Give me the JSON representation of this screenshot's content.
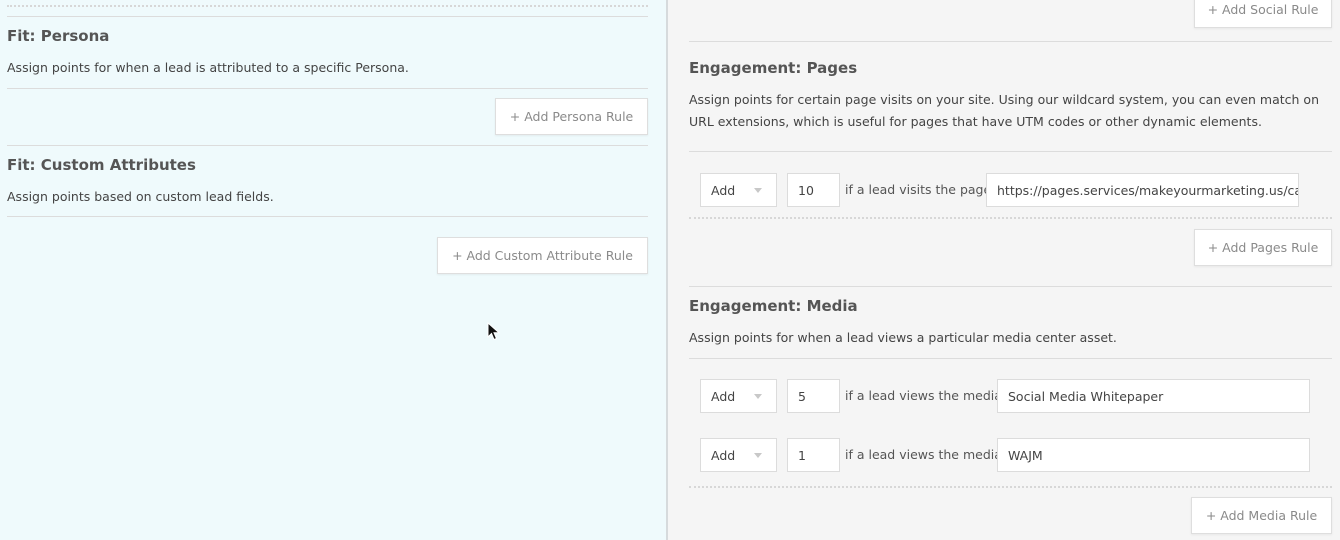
{
  "left": {
    "persona": {
      "title": "Fit: Persona",
      "description": "Assign points for when a lead is attributed to a specific Persona.",
      "button": "+ Add Persona Rule"
    },
    "custom": {
      "title": "Fit: Custom Attributes",
      "description": "Assign points based on custom lead fields.",
      "button": "+ Add Custom Attribute Rule"
    }
  },
  "right": {
    "social_button": "+ Add Social Rule",
    "pages": {
      "title": "Engagement: Pages",
      "description": "Assign points for certain page visits on your site. Using our wildcard system, you can even match on URL extensions, which is useful for pages that have UTM codes or other dynamic elements.",
      "rules": [
        {
          "action": "Add",
          "points": "10",
          "condition": "if a lead visits the page",
          "value": "https://pages.services/makeyourmarketing.us/car"
        }
      ],
      "button": "+ Add Pages Rule"
    },
    "media": {
      "title": "Engagement: Media",
      "description": "Assign points for when a lead views a particular media center asset.",
      "rules": [
        {
          "action": "Add",
          "points": "5",
          "condition": "if a lead views the media",
          "value": "Social Media Whitepaper"
        },
        {
          "action": "Add",
          "points": "1",
          "condition": "if a lead views the media",
          "value": "WAJM"
        }
      ],
      "button": "+ Add Media Rule"
    }
  },
  "icons": {
    "cursor": "mouse-pointer-icon",
    "dropdown": "chevron-down-icon"
  }
}
